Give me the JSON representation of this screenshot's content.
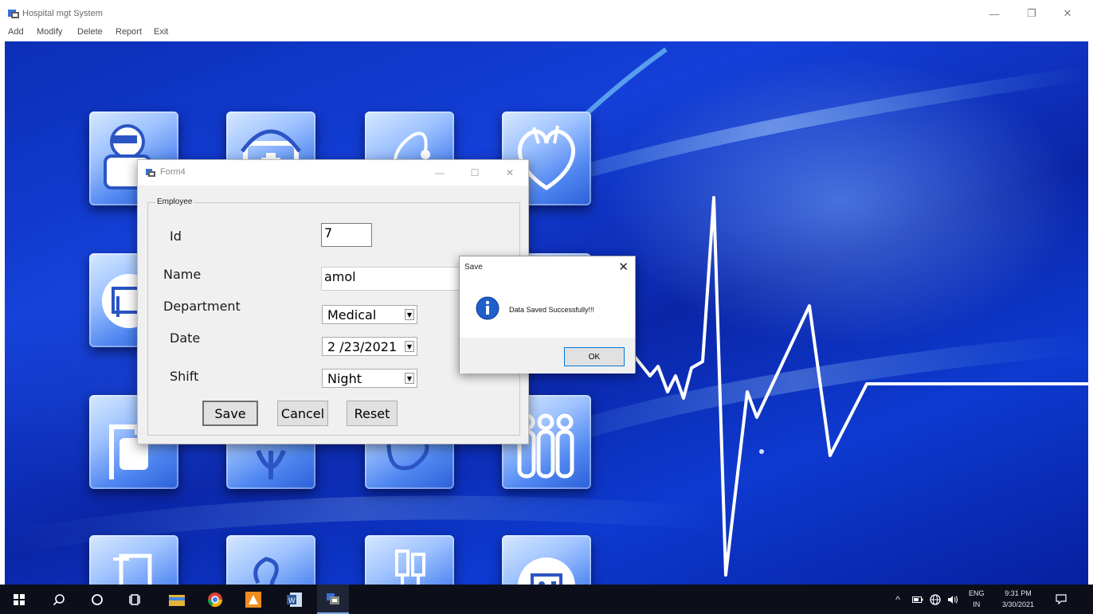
{
  "window": {
    "title": "Hospital mgt System",
    "controls": {
      "minimize": "—",
      "maximize": "❐",
      "close": "✕"
    }
  },
  "menubar": {
    "items": [
      "Add",
      "Modify",
      "Delete",
      "Report",
      "Exit"
    ]
  },
  "background": {
    "icon_tiles": [
      "doctor-icon",
      "medical-kit-icon",
      "stethoscope-icon",
      "heart-icon",
      "hospital-bed-icon",
      "iv-drip-icon",
      "caduceus-icon",
      "kidney-icon",
      "test-tubes-icon",
      "iv-stand-icon",
      "equipment-icon",
      "robot-arm-icon",
      "elevator-icon"
    ],
    "accent": "#0b2fb6",
    "pulse_line_color": "#ffffff"
  },
  "form4": {
    "title": "Form4",
    "controls": {
      "minimize": "—",
      "maximize": "☐",
      "close": "✕"
    },
    "group_title": "Employee",
    "fields": {
      "id": {
        "label": "Id",
        "value": "7"
      },
      "name": {
        "label": "Name",
        "value": "amol"
      },
      "department": {
        "label": "Department",
        "value": "Medical"
      },
      "date": {
        "label": "Date",
        "value": "2 /23/2021"
      },
      "shift": {
        "label": "Shift",
        "value": "Night"
      }
    },
    "buttons": {
      "save": "Save",
      "cancel": "Cancel",
      "reset": "Reset"
    }
  },
  "messagebox": {
    "title": "Save",
    "close": "✕",
    "icon": "info-icon",
    "message": "Data Saved Successfully!!!",
    "ok": "OK"
  },
  "taskbar": {
    "icons": [
      "start-icon",
      "search-icon",
      "cortana-icon",
      "task-view-icon",
      "file-explorer-icon",
      "chrome-icon",
      "app-orange-icon",
      "word-icon",
      "hospital-app-icon"
    ],
    "tray": {
      "language_line1": "ENG",
      "language_line2": "IN",
      "time": "9:31 PM",
      "date": "3/30/2021"
    }
  }
}
